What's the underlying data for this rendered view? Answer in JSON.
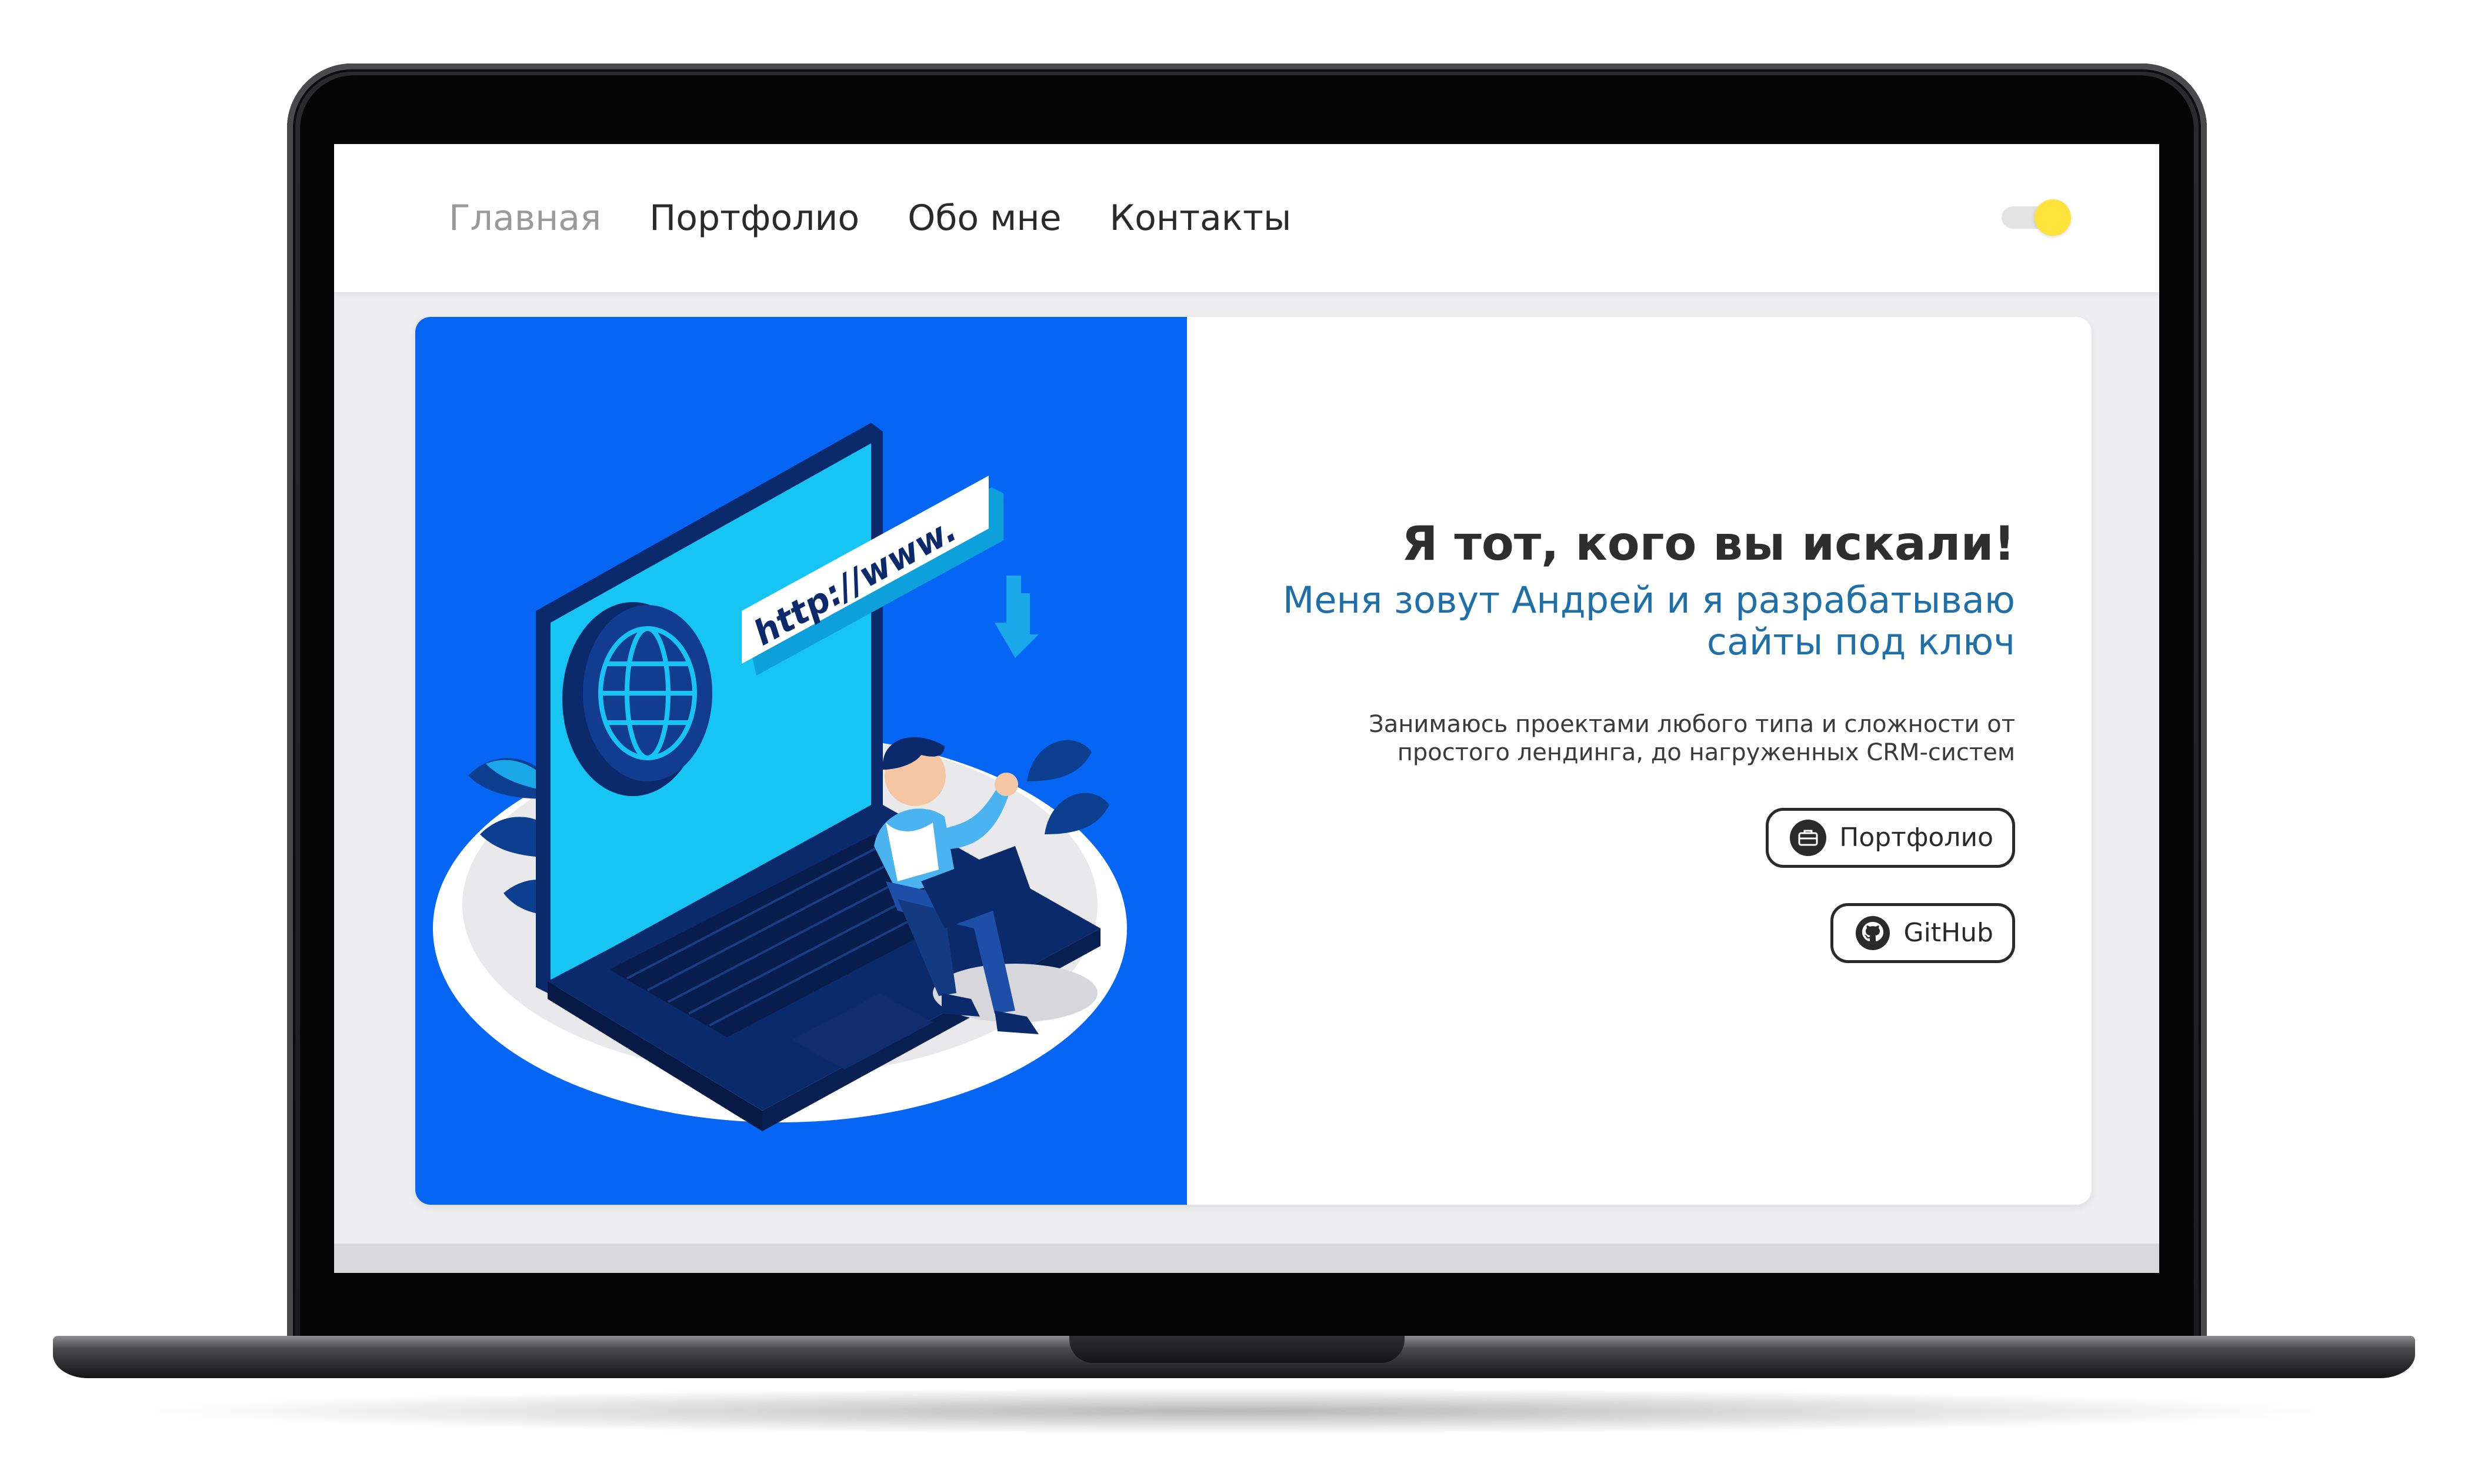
{
  "nav": {
    "items": [
      {
        "label": "Главная",
        "active": true
      },
      {
        "label": "Портфолио",
        "active": false
      },
      {
        "label": "Обо мне",
        "active": false
      },
      {
        "label": "Контакты",
        "active": false
      }
    ],
    "theme_toggle": {
      "state": "on",
      "knob_color": "#ffe23a"
    }
  },
  "hero": {
    "title": "Я тот, кого вы искали!",
    "subtitle_line1": "Меня зовут Андрей и я разрабатываю",
    "subtitle_line2": "сайты под ключ",
    "description_line1": "Занимаюсь проектами любого типа и сложности от",
    "description_line2": "простого лендинга, до нагруженных CRM-систем",
    "buttons": {
      "portfolio": {
        "label": "Портфолио",
        "icon": "briefcase-icon"
      },
      "github": {
        "label": "GitHub",
        "icon": "github-icon"
      }
    },
    "illustration": {
      "url_text": "http://www.",
      "background_color": "#0566f5"
    }
  },
  "colors": {
    "accent": "#1f6fa8",
    "title": "#2e2e2e",
    "page_bg": "#eeeef1"
  }
}
